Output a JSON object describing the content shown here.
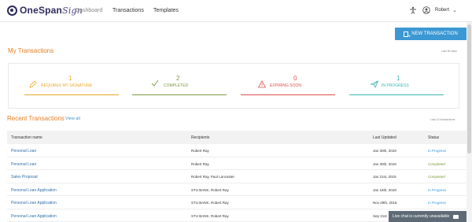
{
  "header": {
    "logo_text": "OneSpan",
    "logo_script": "Sign",
    "nav": {
      "dashboard": "Dashboard",
      "transactions": "Transactions",
      "templates": "Templates"
    },
    "user_name": "Robert",
    "chevron": "⌄"
  },
  "actions": {
    "new_transaction": "NEW TRANSACTION"
  },
  "my_transactions": {
    "title": "My Transactions",
    "range": "Last 30 days",
    "stats": [
      {
        "count": "1",
        "label": "REQUIRES MY SIGNATURE",
        "color": "#e7a92a",
        "icon": "pen-icon"
      },
      {
        "count": "2",
        "label": "COMPLETED",
        "color": "#7c9b3c",
        "icon": "check-icon"
      },
      {
        "count": "0",
        "label": "EXPIRING SOON",
        "color": "#d9534f",
        "icon": "warning-icon"
      },
      {
        "count": "1",
        "label": "IN PROGRESS",
        "color": "#3fb6b3",
        "icon": "send-icon"
      }
    ]
  },
  "recent": {
    "title": "Recent Transactions",
    "view_all": "View all",
    "range": "Last 10 transactions",
    "columns": {
      "name": "Transaction name",
      "recipients": "Recipients",
      "updated": "Last Updated",
      "status": "Status"
    },
    "rows": [
      {
        "name": "Personal Loan",
        "recipients": "Robert Ray",
        "updated": "Jan 30th, 2019",
        "status": "In Progress"
      },
      {
        "name": "Personal Loan",
        "recipients": "Robert Ray",
        "updated": "Jan 30th, 2019",
        "status": "Completed"
      },
      {
        "name": "Sales Proposal",
        "recipients": "Robert Ray, Paul Lancaster",
        "updated": "Jan 21st, 2019",
        "status": "Completed"
      },
      {
        "name": "Personal Loan Application",
        "recipients": "STU BANK, Robert Ray",
        "updated": "Jan 16th, 2019",
        "status": "In Progress"
      },
      {
        "name": "Personal Loan Application",
        "recipients": "STU BANK, Robert Ray",
        "updated": "Nov 29th, 2018",
        "status": "In Progress"
      },
      {
        "name": "Personal Loan Application",
        "recipients": "STU BANK, Robert Ray",
        "updated": "Sep 21st",
        "status": ""
      }
    ]
  },
  "chat": {
    "label": "Live chat is currently unavailable"
  },
  "colors": {
    "accent": "#3c98d3",
    "section_title": "#e67e22",
    "brand": "#2e2a5b"
  }
}
